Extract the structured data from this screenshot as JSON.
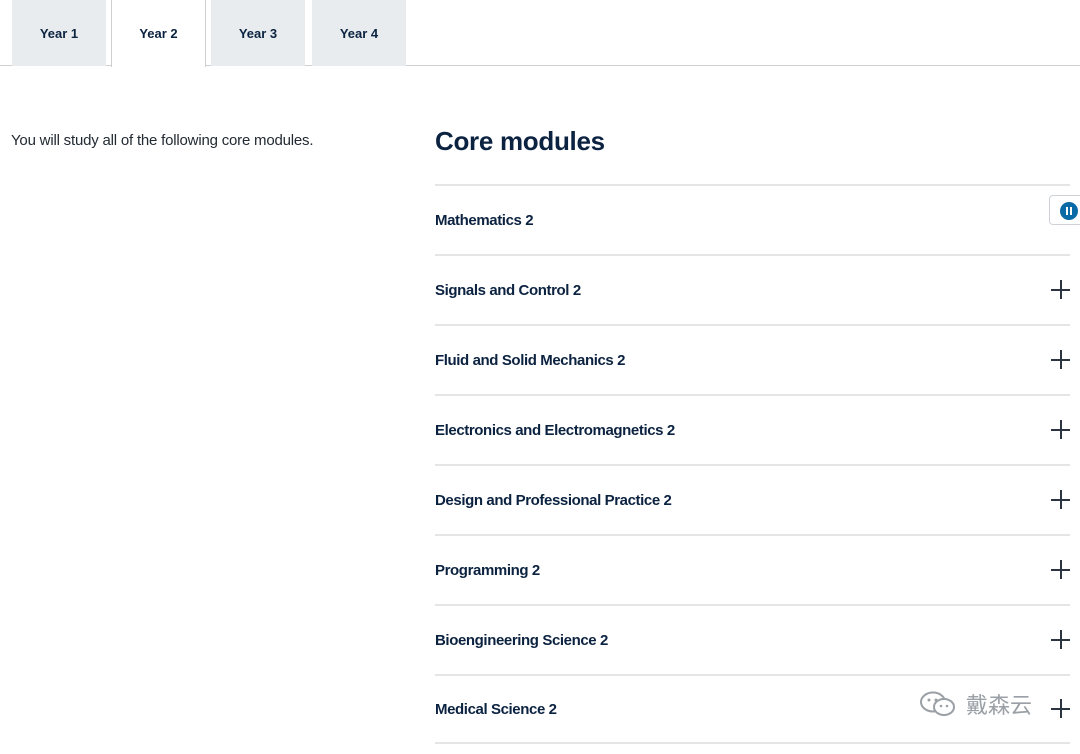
{
  "tabs": [
    {
      "label": "Year 1",
      "active": false
    },
    {
      "label": "Year 2",
      "active": true
    },
    {
      "label": "Year 3",
      "active": false
    },
    {
      "label": "Year 4",
      "active": false
    }
  ],
  "intro": "You will study all of the following core modules.",
  "core_modules": {
    "heading": "Core modules",
    "items": [
      {
        "title": "Mathematics 2"
      },
      {
        "title": "Signals and Control 2"
      },
      {
        "title": "Fluid and Solid Mechanics 2"
      },
      {
        "title": "Electronics and Electromagnetics 2"
      },
      {
        "title": "Design and Professional Practice 2"
      },
      {
        "title": "Programming 2"
      },
      {
        "title": "Bioengineering Science 2"
      },
      {
        "title": "Medical Science 2"
      }
    ]
  },
  "watermark": {
    "text": "戴森云",
    "icon": "wechat-icon"
  },
  "colors": {
    "text": "#0b2240",
    "tab_inactive": "#e9ecee",
    "divider": "#e3e5e7",
    "accent": "#0a6aa6"
  }
}
